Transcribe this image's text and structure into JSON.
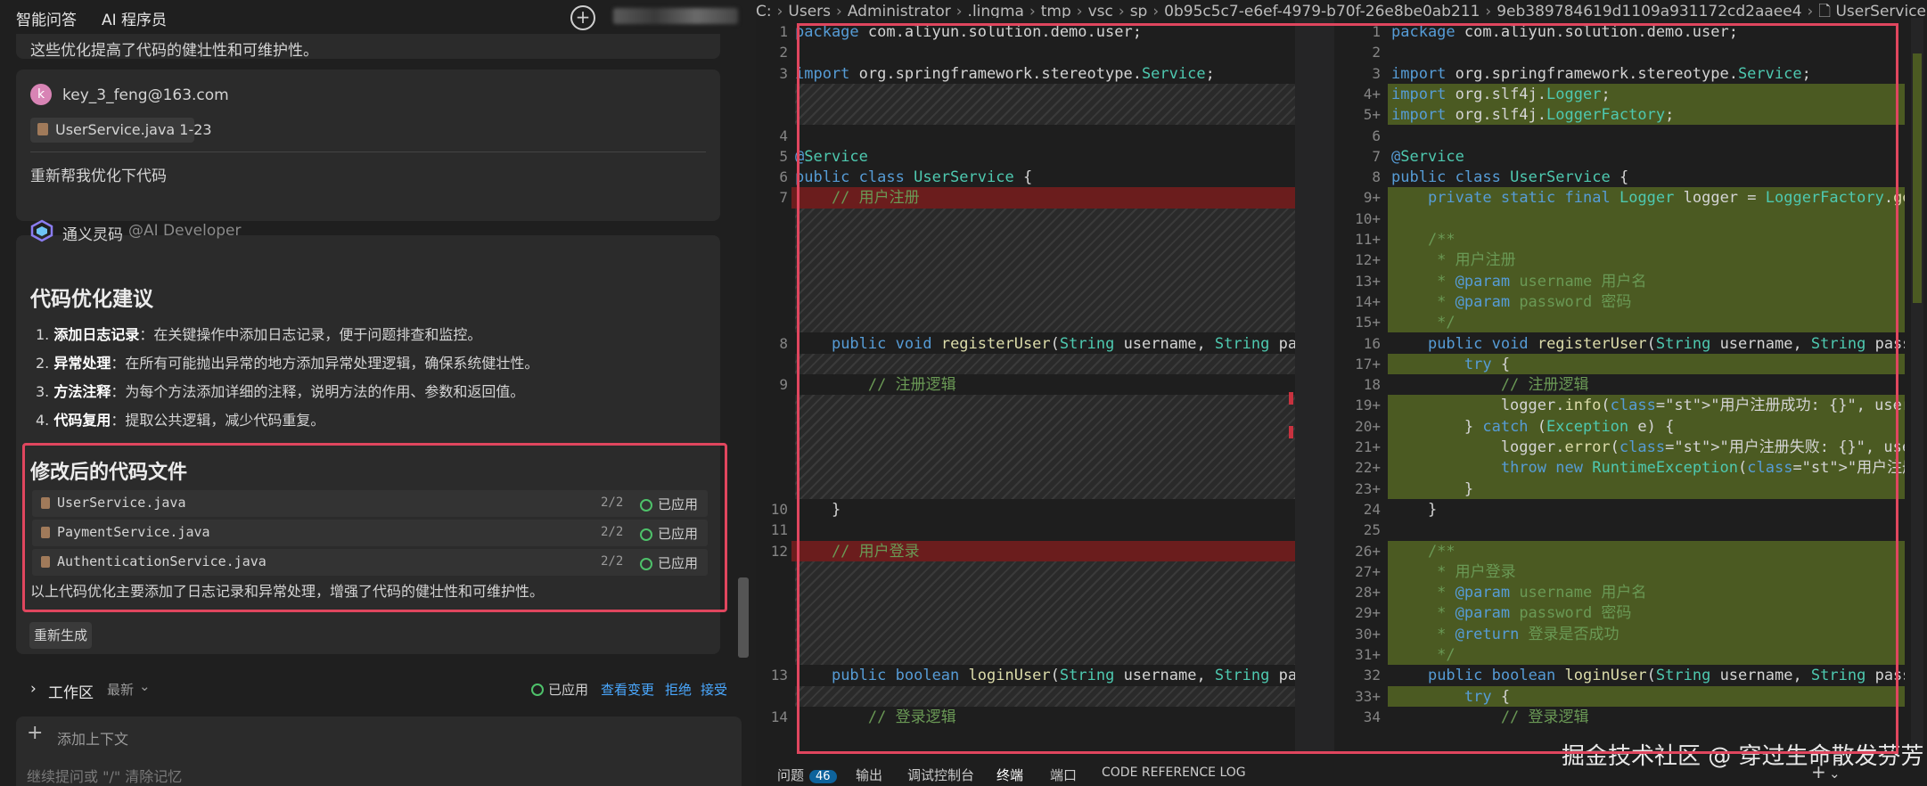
{
  "chat": {
    "tabs": [
      "智能问答",
      "AI 程序员"
    ],
    "prev_line": "这些优化提高了代码的健壮性和可维护性。",
    "user": {
      "avatar_letter": "k",
      "name": "key_3_feng@163.com",
      "file_ref": "UserService.java 1-23",
      "message": "重新帮我优化下代码"
    },
    "assistant": {
      "name": "通义灵码",
      "role": "@AI Developer",
      "section1_title": "代码优化建议",
      "suggestions": [
        {
          "num": "1.",
          "title": "添加日志记录",
          "text": "：在关键操作中添加日志记录，便于问题排查和监控。"
        },
        {
          "num": "2.",
          "title": "异常处理",
          "text": "：在所有可能抛出异常的地方添加异常处理逻辑，确保系统健壮性。"
        },
        {
          "num": "3.",
          "title": "方法注释",
          "text": "：为每个方法添加详细的注释，说明方法的作用、参数和返回值。"
        },
        {
          "num": "4.",
          "title": "代码复用",
          "text": "：提取公共逻辑，减少代码重复。"
        }
      ],
      "section2_title": "修改后的代码文件",
      "files": [
        {
          "name": "UserService.java",
          "count": "2/2",
          "status": "已应用"
        },
        {
          "name": "PaymentService.java",
          "count": "2/2",
          "status": "已应用"
        },
        {
          "name": "AuthenticationService.java",
          "count": "2/2",
          "status": "已应用"
        }
      ],
      "summary": "以上代码优化主要添加了日志记录和异常处理，增强了代码的健壮性和可维护性。",
      "regen_label": "重新生成"
    },
    "workspace": {
      "label": "工作区",
      "sort": "最新",
      "applied": "已应用",
      "view_changes": "查看变更",
      "reject": "拒绝",
      "accept": "接受"
    },
    "input": {
      "add_context": "添加上下文",
      "placeholder": "继续提问或 \"/\" 清除记忆"
    }
  },
  "editor": {
    "breadcrumb": [
      "C:",
      "Users",
      "Administrator",
      ".lingma",
      "tmp",
      "vsc",
      "sp",
      "0b95c5c7-e6ef-4979-b70f-26e8be0ab211",
      "9eb389784619d1109a931172cd2aaee4",
      "UserService.java"
    ],
    "left_lines": [
      {
        "n": "1",
        "text": "package com.aliyun.solution.demo.user;"
      },
      {
        "n": "2",
        "text": ""
      },
      {
        "n": "3",
        "text": "import org.springframework.stereotype.Service;"
      },
      {
        "n": "4",
        "text": ""
      },
      {
        "n": "5",
        "text": "@Service"
      },
      {
        "n": "6",
        "text": "public class UserService {"
      },
      {
        "n": "7",
        "text": "    // 用户注册"
      },
      {
        "n": "8",
        "text": "    public void registerUser(String username, String pa"
      },
      {
        "n": "9",
        "text": "        // 注册逻辑"
      },
      {
        "n": "10",
        "text": "    }"
      },
      {
        "n": "11",
        "text": ""
      },
      {
        "n": "12",
        "text": "    // 用户登录"
      },
      {
        "n": "13",
        "text": "    public boolean loginUser(String username, String pa"
      },
      {
        "n": "14",
        "text": "        // 登录逻辑"
      }
    ],
    "right_lines": [
      {
        "n": "1",
        "text": "package com.aliyun.solution.demo.user;"
      },
      {
        "n": "2",
        "text": ""
      },
      {
        "n": "3",
        "text": "import org.springframework.stereotype.Service;"
      },
      {
        "n": "4+",
        "text": "import org.slf4j.Logger;"
      },
      {
        "n": "5+",
        "text": "import org.slf4j.LoggerFactory;"
      },
      {
        "n": "6",
        "text": ""
      },
      {
        "n": "7",
        "text": "@Service"
      },
      {
        "n": "8",
        "text": "public class UserService {"
      },
      {
        "n": "9+",
        "text": "    private static final Logger logger = LoggerFactory.getL"
      },
      {
        "n": "10+",
        "text": ""
      },
      {
        "n": "11+",
        "text": "    /**"
      },
      {
        "n": "12+",
        "text": "     * 用户注册"
      },
      {
        "n": "13+",
        "text": "     * @param username 用户名"
      },
      {
        "n": "14+",
        "text": "     * @param password 密码"
      },
      {
        "n": "15+",
        "text": "     */"
      },
      {
        "n": "16",
        "text": "    public void registerUser(String username, String passwo"
      },
      {
        "n": "17+",
        "text": "        try {"
      },
      {
        "n": "18",
        "text": "            // 注册逻辑"
      },
      {
        "n": "19+",
        "text": "            logger.info(\"用户注册成功: {}\", username);"
      },
      {
        "n": "20+",
        "text": "        } catch (Exception e) {"
      },
      {
        "n": "21+",
        "text": "            logger.error(\"用户注册失败: {}\", username, e);"
      },
      {
        "n": "22+",
        "text": "            throw new RuntimeException(\"用户注册失败\", e);"
      },
      {
        "n": "23+",
        "text": "        }"
      },
      {
        "n": "24",
        "text": "    }"
      },
      {
        "n": "25",
        "text": ""
      },
      {
        "n": "26+",
        "text": "    /**"
      },
      {
        "n": "27+",
        "text": "     * 用户登录"
      },
      {
        "n": "28+",
        "text": "     * @param username 用户名"
      },
      {
        "n": "29+",
        "text": "     * @param password 密码"
      },
      {
        "n": "30+",
        "text": "     * @return 登录是否成功"
      },
      {
        "n": "31+",
        "text": "     */"
      },
      {
        "n": "32",
        "text": "    public boolean loginUser(String username, String passwo"
      },
      {
        "n": "33+",
        "text": "        try {"
      },
      {
        "n": "34",
        "text": "            // 登录逻辑"
      }
    ]
  },
  "statusbar": {
    "problems": "问题",
    "problems_count": "46",
    "output": "输出",
    "debug_console": "调试控制台",
    "terminal": "终端",
    "ports": "端口",
    "code_reference": "CODE REFERENCE LOG"
  },
  "watermark": "掘金技术社区 @ 穿过生命散发芬芳"
}
